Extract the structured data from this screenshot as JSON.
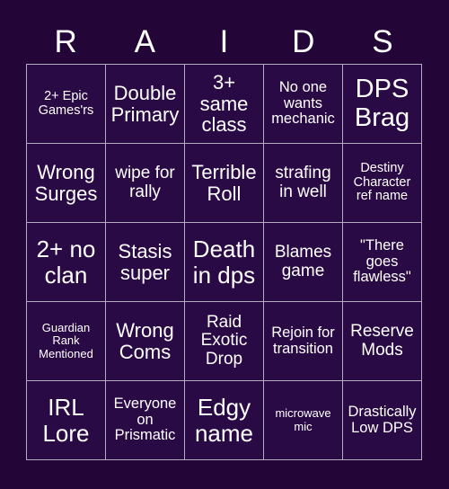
{
  "background_color": "#230538",
  "cell_color": "#2a0a45",
  "border_color": "#b3abc1",
  "text_color": "#ffffff",
  "header": {
    "title": "RAIDS",
    "letters": [
      "R",
      "A",
      "I",
      "D",
      "S"
    ]
  },
  "grid": {
    "rows": 5,
    "columns": 5,
    "cells": [
      {
        "text": "2+ Epic Games'rs",
        "size": "fs-s"
      },
      {
        "text": "Double Primary",
        "size": "fs-xl"
      },
      {
        "text": "3+ same class",
        "size": "fs-xl"
      },
      {
        "text": "No one wants mechanic",
        "size": "fs-m"
      },
      {
        "text": "DPS Brag",
        "size": "fs-huge"
      },
      {
        "text": "Wrong Surges",
        "size": "fs-xl"
      },
      {
        "text": "wipe for rally",
        "size": "fs-l"
      },
      {
        "text": "Terrible Roll",
        "size": "fs-xl"
      },
      {
        "text": "strafing in well",
        "size": "fs-l"
      },
      {
        "text": "Destiny Character ref name",
        "size": "fs-s"
      },
      {
        "text": "2+ no clan",
        "size": "fs-xxl"
      },
      {
        "text": "Stasis super",
        "size": "fs-xl"
      },
      {
        "text": "Death in dps",
        "size": "fs-xxl"
      },
      {
        "text": "Blames game",
        "size": "fs-l"
      },
      {
        "text": "\"There goes flawless\"",
        "size": "fs-m"
      },
      {
        "text": "Guardian Rank Mentioned",
        "size": "fs-xs"
      },
      {
        "text": "Wrong Coms",
        "size": "fs-xl"
      },
      {
        "text": "Raid Exotic Drop",
        "size": "fs-l"
      },
      {
        "text": "Rejoin for transition",
        "size": "fs-m"
      },
      {
        "text": "Reserve Mods",
        "size": "fs-l"
      },
      {
        "text": "IRL Lore",
        "size": "fs-xxl"
      },
      {
        "text": "Everyone on Prismatic",
        "size": "fs-m"
      },
      {
        "text": "Edgy name",
        "size": "fs-xxl"
      },
      {
        "text": "microwave mic",
        "size": "fs-xs"
      },
      {
        "text": "Drastically Low DPS",
        "size": "fs-m"
      }
    ]
  }
}
